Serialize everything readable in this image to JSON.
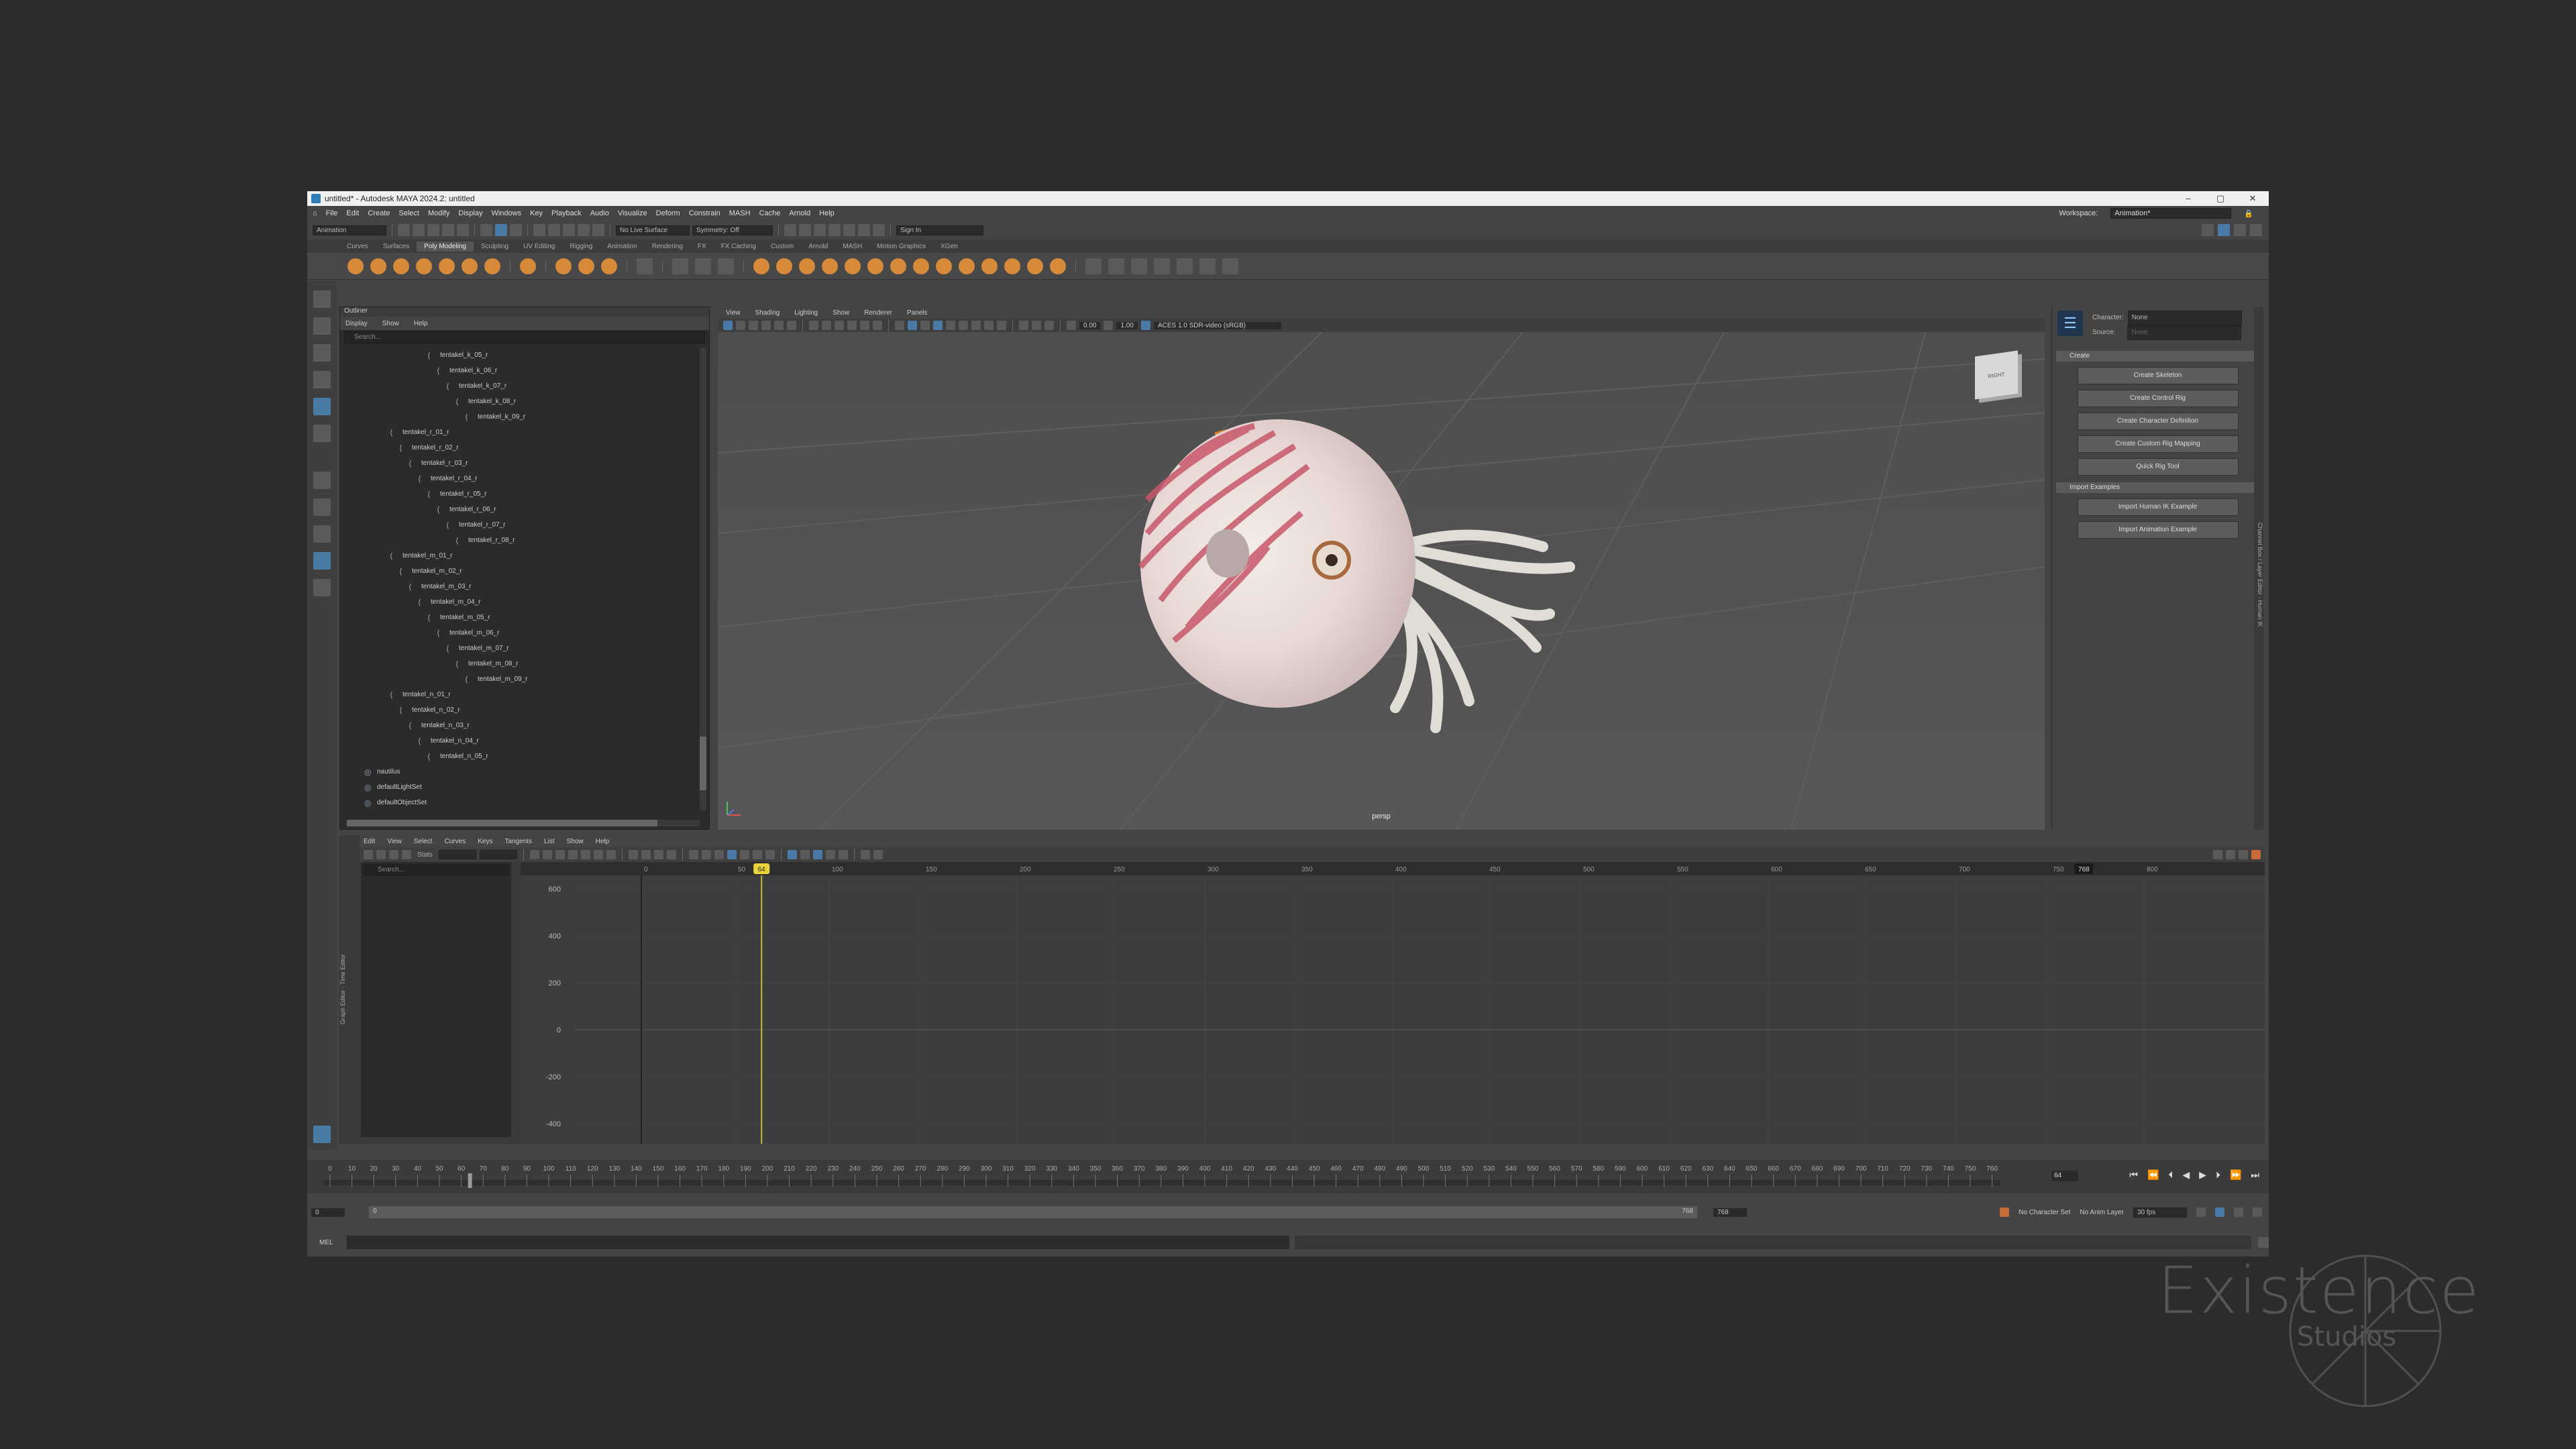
{
  "window": {
    "title": "untitled* - Autodesk MAYA 2024.2: untitled",
    "controls": [
      "–",
      "▢",
      "✕"
    ]
  },
  "menubar": {
    "items": [
      "File",
      "Edit",
      "Create",
      "Select",
      "Modify",
      "Display",
      "Windows",
      "Key",
      "Playback",
      "Audio",
      "Visualize",
      "Deform",
      "Constrain",
      "MASH",
      "Cache",
      "Arnold",
      "Help"
    ],
    "workspace_label": "Workspace:",
    "workspace_value": "Animation*"
  },
  "statusline": {
    "mode": "Animation",
    "live_surface": "No Live Surface",
    "symmetry": "Symmetry: Off",
    "sign_in": "Sign In"
  },
  "shelf": {
    "tabs": [
      "Curves",
      "Surfaces",
      "Poly Modeling",
      "Sculpting",
      "UV Editing",
      "Rigging",
      "Animation",
      "Rendering",
      "FX",
      "FX Caching",
      "Custom",
      "Arnold",
      "MASH",
      "Motion Graphics",
      "XGen"
    ],
    "active_tab": "Poly Modeling"
  },
  "outliner": {
    "title": "Outliner",
    "menu": [
      "Display",
      "Show",
      "Help"
    ],
    "search_placeholder": "Search...",
    "items": [
      {
        "label": "tentakel_k_05_r",
        "depth": 5
      },
      {
        "label": "tentakel_k_06_r",
        "depth": 6
      },
      {
        "label": "tentakel_k_07_r",
        "depth": 7
      },
      {
        "label": "tentakel_k_08_r",
        "depth": 8
      },
      {
        "label": "tentakel_k_09_r",
        "depth": 9
      },
      {
        "label": "tentakel_r_01_r",
        "depth": 1
      },
      {
        "label": "tentakel_r_02_r",
        "depth": 2
      },
      {
        "label": "tentakel_r_03_r",
        "depth": 3
      },
      {
        "label": "tentakel_r_04_r",
        "depth": 4
      },
      {
        "label": "tentakel_r_05_r",
        "depth": 5
      },
      {
        "label": "tentakel_r_06_r",
        "depth": 6
      },
      {
        "label": "tentakel_r_07_r",
        "depth": 7
      },
      {
        "label": "tentakel_r_08_r",
        "depth": 8
      },
      {
        "label": "tentakel_m_01_r",
        "depth": 1
      },
      {
        "label": "tentakel_m_02_r",
        "depth": 2
      },
      {
        "label": "tentakel_m_03_r",
        "depth": 3
      },
      {
        "label": "tentakel_m_04_r",
        "depth": 4
      },
      {
        "label": "tentakel_m_05_r",
        "depth": 5
      },
      {
        "label": "tentakel_m_06_r",
        "depth": 6
      },
      {
        "label": "tentakel_m_07_r",
        "depth": 7
      },
      {
        "label": "tentakel_m_08_r",
        "depth": 8
      },
      {
        "label": "tentakel_m_09_r",
        "depth": 9
      },
      {
        "label": "tentakel_n_01_r",
        "depth": 1
      },
      {
        "label": "tentakel_n_02_r",
        "depth": 2
      },
      {
        "label": "tentakel_n_03_r",
        "depth": 3
      },
      {
        "label": "tentakel_n_04_r",
        "depth": 4
      },
      {
        "label": "tentakel_n_05_r",
        "depth": 5
      },
      {
        "label": "nautilus",
        "depth": 0
      },
      {
        "label": "defaultLightSet",
        "depth": 0
      },
      {
        "label": "defaultObjectSet",
        "depth": 0
      }
    ]
  },
  "viewport": {
    "menu": [
      "View",
      "Shading",
      "Lighting",
      "Show",
      "Renderer",
      "Panels"
    ],
    "near": "0.00",
    "far": "1.00",
    "colorspace": "ACES 1.0 SDR-video (sRGB)",
    "camera_label": "persp",
    "viewcube_label": "RIGHT"
  },
  "hik": {
    "character_label": "Character:",
    "character_value": "None",
    "source_label": "Source:",
    "source_value": "None",
    "create_section": "Create",
    "create_buttons": [
      "Create Skeleton",
      "Create Control Rig",
      "Create Character Definition",
      "Create Custom Rig Mapping",
      "Quick Rig Tool"
    ],
    "import_section": "Import Examples",
    "import_buttons": [
      "Import Human IK Example",
      "Import Animation Example"
    ],
    "side_tabs": [
      "Channel Box / Layer Editor",
      "Human IK"
    ]
  },
  "graph_editor": {
    "side_tabs": [
      "Graph Editor",
      "Time Editor"
    ],
    "menu": [
      "Edit",
      "View",
      "Select",
      "Curves",
      "Keys",
      "Tangents",
      "List",
      "Show",
      "Help"
    ],
    "stats_label": "Stats",
    "search_placeholder": "Search...",
    "top_ruler": [
      "0",
      "50",
      "100",
      "150",
      "200",
      "250",
      "300",
      "350",
      "400",
      "450",
      "500",
      "550",
      "600",
      "650",
      "700",
      "750",
      "800"
    ],
    "current_marker": "64",
    "end_marker": "768",
    "y_labels": [
      "600",
      "400",
      "200",
      "0",
      "-200",
      "-400"
    ]
  },
  "timeslider": {
    "ticks": [
      "0",
      "10",
      "20",
      "30",
      "40",
      "50",
      "60",
      "70",
      "80",
      "90",
      "100",
      "110",
      "120",
      "130",
      "140",
      "150",
      "160",
      "170",
      "180",
      "190",
      "200",
      "210",
      "220",
      "230",
      "240",
      "250",
      "260",
      "270",
      "280",
      "290",
      "300",
      "310",
      "320",
      "330",
      "340",
      "350",
      "360",
      "370",
      "380",
      "390",
      "400",
      "410",
      "420",
      "430",
      "440",
      "450",
      "460",
      "470",
      "480",
      "490",
      "500",
      "510",
      "520",
      "530",
      "540",
      "550",
      "560",
      "570",
      "580",
      "590",
      "600",
      "610",
      "620",
      "630",
      "640",
      "650",
      "660",
      "670",
      "680",
      "690",
      "700",
      "710",
      "720",
      "730",
      "740",
      "750",
      "760"
    ],
    "current_frame": "64",
    "playback": [
      "⏮",
      "⏪",
      "⏴",
      "◀",
      "▶",
      "⏵",
      "⏩",
      "⏭"
    ]
  },
  "rangebar": {
    "start": "0",
    "inner_start": "0",
    "inner_end": "768",
    "end": "768",
    "character_set": "No Character Set",
    "anim_layer": "No Anim Layer",
    "fps": "30 fps"
  },
  "cmdline": {
    "label": "MEL"
  },
  "watermark": {
    "title": "Existence",
    "subtitle": "Studios"
  }
}
